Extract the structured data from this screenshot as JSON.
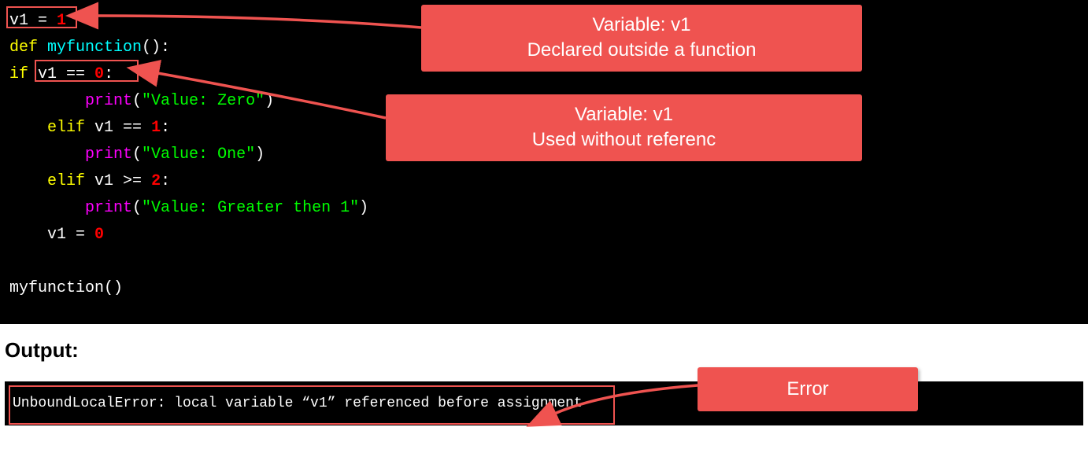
{
  "code": {
    "l1_v1": "v1 ",
    "l1_eq": "= ",
    "l1_val": "1",
    "l2_def": "def ",
    "l2_name": "myfunction",
    "l2_paren": "():",
    "l3_if": "if ",
    "l3_var": "v1 ",
    "l3_op": "== ",
    "l3_val": "0",
    "l3_colon": ":",
    "l4_print": "print",
    "l4_paren_open": "(",
    "l4_str": "\"Value: Zero\"",
    "l4_paren_close": ")",
    "l5_elif": "elif ",
    "l5_var": "v1 ",
    "l5_op": "== ",
    "l5_val": "1",
    "l5_colon": ":",
    "l6_print": "print",
    "l6_paren_open": "(",
    "l6_str": "\"Value: One\"",
    "l6_paren_close": ")",
    "l7_elif": "elif ",
    "l7_var": "v1 ",
    "l7_op": ">= ",
    "l7_val": "2",
    "l7_colon": ":",
    "l8_print": "print",
    "l8_paren_open": "(",
    "l8_str": "\"Value: Greater then 1\"",
    "l8_paren_close": ")",
    "l9_var": "v1 ",
    "l9_eq": "= ",
    "l9_val": "0",
    "l10_call": "myfunction()"
  },
  "callouts": {
    "c1_line1": "Variable: v1",
    "c1_line2": "Declared outside a function",
    "c2_line1": "Variable: v1",
    "c2_line2": "Used without referenc",
    "c3": "Error"
  },
  "output": {
    "label": "Output:",
    "text": "UnboundLocalError: local variable “v1” referenced before assignment"
  }
}
